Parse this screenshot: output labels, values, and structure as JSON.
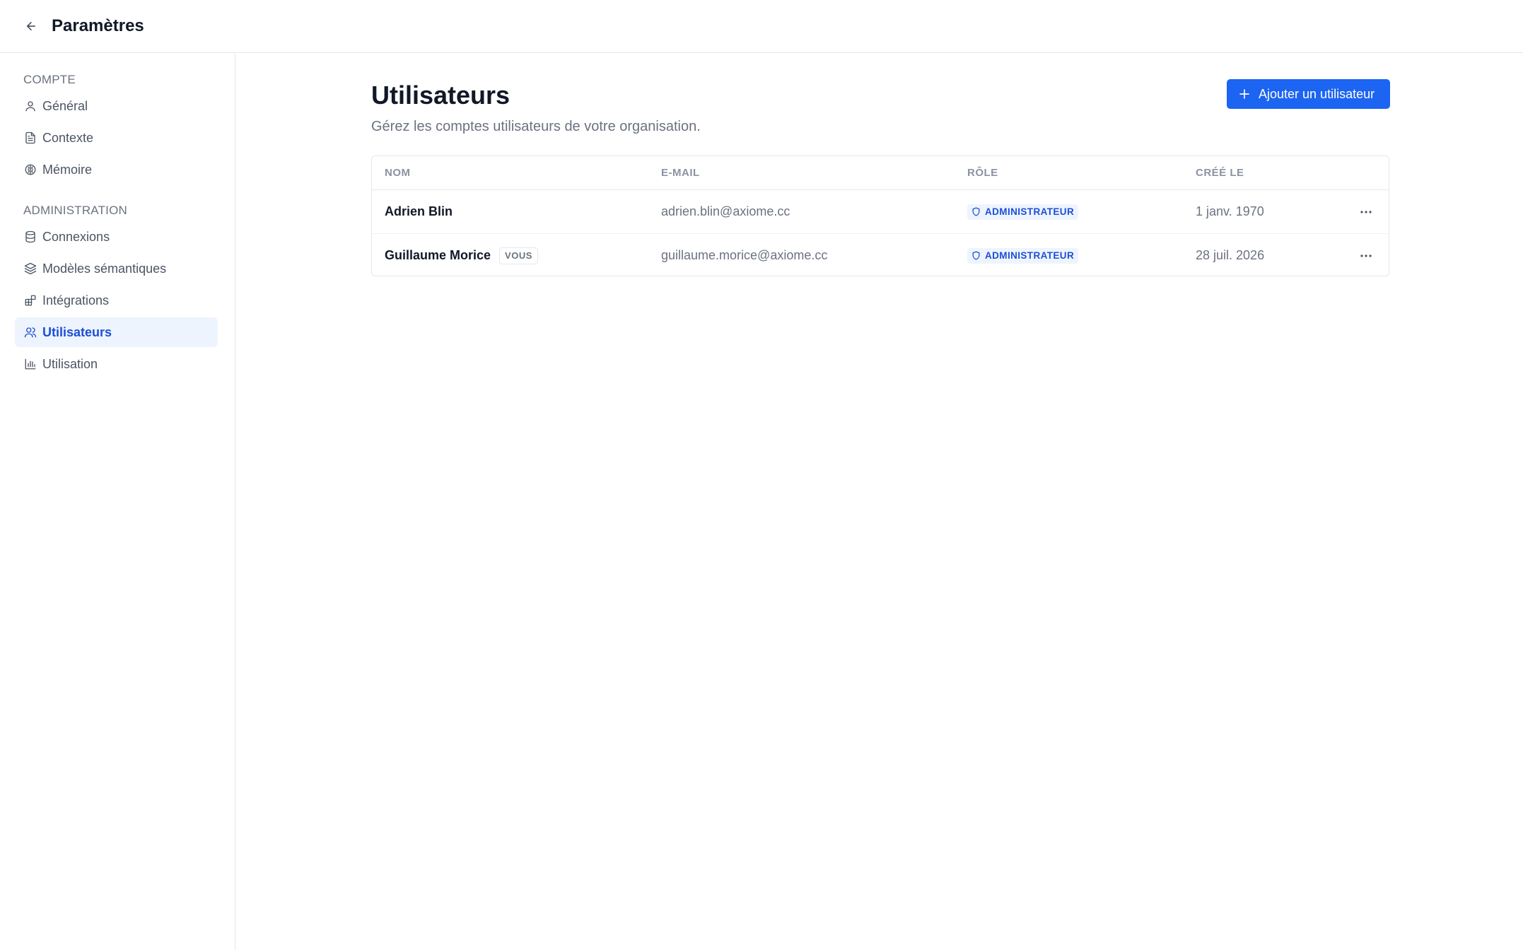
{
  "header": {
    "title": "Paramètres",
    "back_icon": "arrow-left-icon"
  },
  "sidebar": {
    "sections": [
      {
        "label": "COMPTE",
        "items": [
          {
            "label": "Général",
            "icon": "user-icon"
          },
          {
            "label": "Contexte",
            "icon": "document-icon"
          },
          {
            "label": "Mémoire",
            "icon": "brain-icon"
          }
        ]
      },
      {
        "label": "ADMINISTRATION",
        "items": [
          {
            "label": "Connexions",
            "icon": "database-icon"
          },
          {
            "label": "Modèles sémantiques",
            "icon": "layers-icon"
          },
          {
            "label": "Intégrations",
            "icon": "puzzle-icon"
          },
          {
            "label": "Utilisateurs",
            "icon": "users-icon",
            "active": true
          },
          {
            "label": "Utilisation",
            "icon": "bar-chart-icon"
          }
        ]
      }
    ]
  },
  "main": {
    "title": "Utilisateurs",
    "subtitle": "Gérez les comptes utilisateurs de votre organisation.",
    "add_button": "Ajouter un utilisateur",
    "table": {
      "headers": [
        "NOM",
        "E-MAIL",
        "RÔLE",
        "CRÉÉ LE"
      ],
      "rows": [
        {
          "name": "Adrien Blin",
          "badge": "",
          "email": "adrien.blin@axiome.cc",
          "role": "ADMINISTRATEUR",
          "created": "1 janv. 1970"
        },
        {
          "name": "Guillaume Morice",
          "badge": "VOUS",
          "email": "guillaume.morice@axiome.cc",
          "role": "ADMINISTRATEUR",
          "created": "28 juil. 2026"
        }
      ]
    }
  },
  "colors": {
    "accent": "#1c64f2",
    "active_bg": "#eef4fd",
    "active_text": "#1d4ed8",
    "muted": "#6b7280",
    "border": "#e5e7eb"
  }
}
